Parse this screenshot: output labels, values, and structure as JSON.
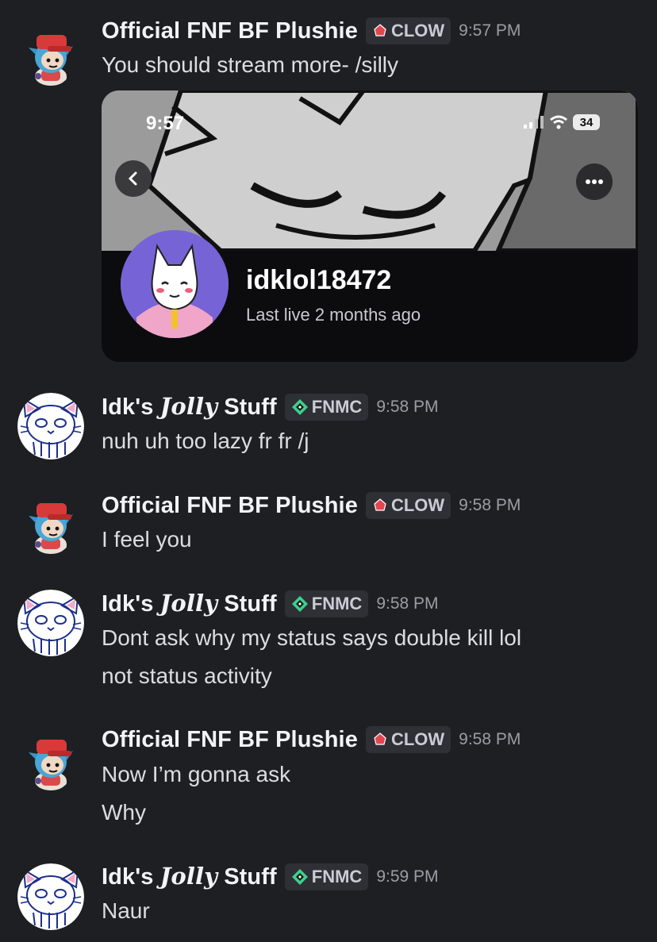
{
  "messages": [
    {
      "author": "Official FNF BF Plushie",
      "tag": "CLOW",
      "time": "9:57 PM",
      "lines": [
        "You should stream more- /silly"
      ],
      "embed": {
        "status_time": "9:57",
        "battery": "34",
        "profile_name": "idklol18472",
        "profile_sub": "Last live 2 months ago"
      }
    },
    {
      "author_pre": "Idk's",
      "author_fancy": "Jolly",
      "author_post": "Stuff",
      "tag": "FNMC",
      "time": "9:58 PM",
      "lines": [
        "nuh uh too lazy fr fr /j"
      ]
    },
    {
      "author": "Official FNF BF Plushie",
      "tag": "CLOW",
      "time": "9:58 PM",
      "lines": [
        "I feel you"
      ]
    },
    {
      "author_pre": "Idk's",
      "author_fancy": "Jolly",
      "author_post": "Stuff",
      "tag": "FNMC",
      "time": "9:58 PM",
      "lines": [
        "Dont ask why my status says double kill lol",
        "not status activity"
      ]
    },
    {
      "author": "Official FNF BF Plushie",
      "tag": "CLOW",
      "time": "9:58 PM",
      "lines": [
        "Now I’m gonna ask",
        "Why"
      ]
    },
    {
      "author_pre": "Idk's",
      "author_fancy": "Jolly",
      "author_post": "Stuff",
      "tag": "FNMC",
      "time": "9:59 PM",
      "lines": [
        "Naur"
      ]
    }
  ],
  "colors": {
    "background": "#1e1f23",
    "clow_gem": "#e2474f",
    "fnmc_gem": "#3ecf8e"
  },
  "icons": {
    "clow_tag": "red-gem-icon",
    "fnmc_tag": "green-diamond-icon",
    "back": "chevron-left-icon",
    "more": "ellipsis-icon"
  }
}
